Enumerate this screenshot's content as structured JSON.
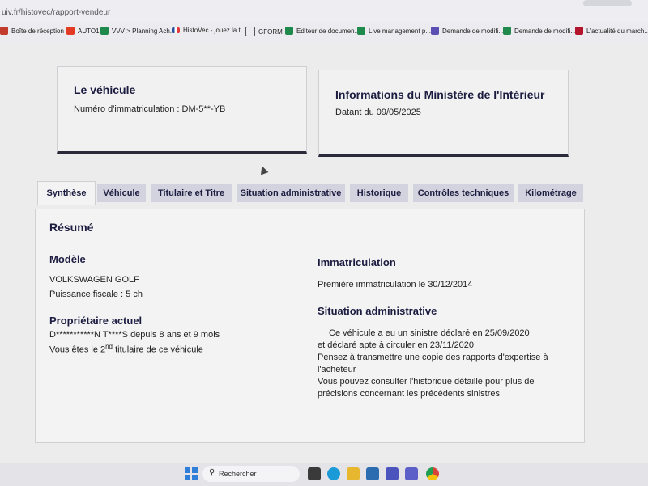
{
  "browser": {
    "url": "uiv.fr/histovec/rapport-vendeur",
    "bookmarks": [
      {
        "label": "Boîte de réception -...",
        "icon": "mail-icon",
        "color": "#c23b2c"
      },
      {
        "label": "AUTO1",
        "icon": "auto1-icon",
        "color": "#e33a23"
      },
      {
        "label": "VVV > Planning Ach...",
        "icon": "sheets-icon",
        "color": "#1f8a4c"
      },
      {
        "label": "HistoVec - jouez la t...",
        "icon": "flag-fr-icon",
        "color": "#2552a0"
      },
      {
        "label": "GFORM",
        "icon": "folder-icon",
        "color": "#555555"
      },
      {
        "label": "Editeur de documen...",
        "icon": "sheets-icon",
        "color": "#1f8a4c"
      },
      {
        "label": "Live management p...",
        "icon": "sheets-icon",
        "color": "#1f8a4c"
      },
      {
        "label": "Demande de modifi...",
        "icon": "form-icon",
        "color": "#5a4fb3"
      },
      {
        "label": "Demande de modifi...",
        "icon": "sheets-icon",
        "color": "#1f8a4c"
      },
      {
        "label": "L'actualité du march...",
        "icon": "news-icon",
        "color": "#b3132b"
      }
    ]
  },
  "vehicle_card": {
    "title": "Le véhicule",
    "plate": "Numéro d'immatriculation : DM-5**-YB"
  },
  "ministry_card": {
    "title": "Informations du Ministère de l'Intérieur",
    "date": "Datant du 09/05/2025"
  },
  "tabs": [
    {
      "label": "Synthèse",
      "active": true
    },
    {
      "label": "Véhicule",
      "active": false
    },
    {
      "label": "Titulaire et Titre",
      "active": false
    },
    {
      "label": "Situation administrative",
      "active": false
    },
    {
      "label": "Historique",
      "active": false
    },
    {
      "label": "Contrôles techniques",
      "active": false
    },
    {
      "label": "Kilométrage",
      "active": false
    }
  ],
  "summary": {
    "heading": "Résumé",
    "model_heading": "Modèle",
    "model_name": "VOLKSWAGEN GOLF",
    "fiscal_power": "Puissance fiscale : 5 ch",
    "owner_heading": "Propriétaire actuel",
    "owner_line": "D***********N T****S depuis 8 ans et 9 mois",
    "owner_rank_pre": "Vous êtes le 2",
    "owner_rank_sup": "nd",
    "owner_rank_post": " titulaire de ce véhicule",
    "registration_heading": "Immatriculation",
    "first_registration": "Première immatriculation le 30/12/2014",
    "admin_heading": "Situation administrative",
    "admin_lines": [
      "Ce véhicule a eu un sinistre déclaré en 25/09/2020",
      "et déclaré apte à circuler en 23/11/2020",
      "Pensez à transmettre une copie des rapports d'expertise à",
      "l'acheteur",
      "Vous pouvez consulter l'historique détaillé pour plus de",
      "précisions concernant les précédents sinistres"
    ]
  },
  "taskbar": {
    "search_placeholder": "Rechercher",
    "apps": [
      {
        "icon": "task-view-icon",
        "color": "#3a3a3a"
      },
      {
        "icon": "edge-icon",
        "color": "#1a9ad6"
      },
      {
        "icon": "file-explorer-icon",
        "color": "#e8b730"
      },
      {
        "icon": "store-icon",
        "color": "#2b6cb0"
      },
      {
        "icon": "teams-chat-icon",
        "color": "#4b53bc"
      },
      {
        "icon": "teams-icon",
        "color": "#5b5fc7"
      },
      {
        "icon": "chrome-icon",
        "color": "#d9443a"
      }
    ]
  }
}
